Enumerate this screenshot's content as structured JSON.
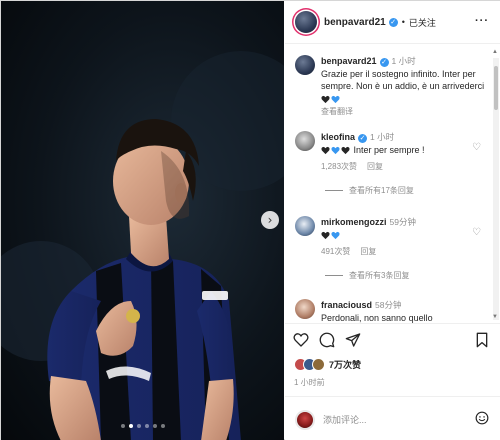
{
  "post": {
    "next_glyph": "›",
    "carousel": {
      "total": 6,
      "active": 1
    }
  },
  "header": {
    "username": "benpavard21",
    "separator": "•",
    "follow_status": "已关注",
    "more": "···"
  },
  "caption": {
    "username": "benpavard21",
    "time": "1 小时",
    "text": "Grazie per il sostegno infinito. Inter per sempre. Non è un addio, è un arrivederci",
    "emoji": [
      "black-heart",
      "blue-heart"
    ],
    "translate": "查看翻译"
  },
  "comments": [
    {
      "username": "kleofina",
      "time": "1 小时",
      "emoji": [
        "black-heart",
        "blue-heart",
        "black-heart"
      ],
      "text": "Inter per sempre !",
      "likes": "1,283次赞",
      "reply": "回复",
      "view_replies": "查看所有17条回复"
    },
    {
      "username": "mirkomengozzi",
      "time": "59分钟",
      "emoji": [
        "black-heart",
        "blue-heart"
      ],
      "text": "",
      "likes": "491次赞",
      "reply": "回复",
      "view_replies": "查看所有3条回复"
    },
    {
      "username": "franaciousd",
      "time": "58分钟",
      "text": "Perdonali, non sanno quello"
    }
  ],
  "actions": {
    "likes": "7万次赞",
    "posted": "1 小时前"
  },
  "comment_box": {
    "placeholder": "添加评论..."
  },
  "colors": {
    "blue_heart": "#3897f0",
    "black_heart": "#262626",
    "verified": "#3897f0",
    "story_ring": "#e1306c"
  }
}
